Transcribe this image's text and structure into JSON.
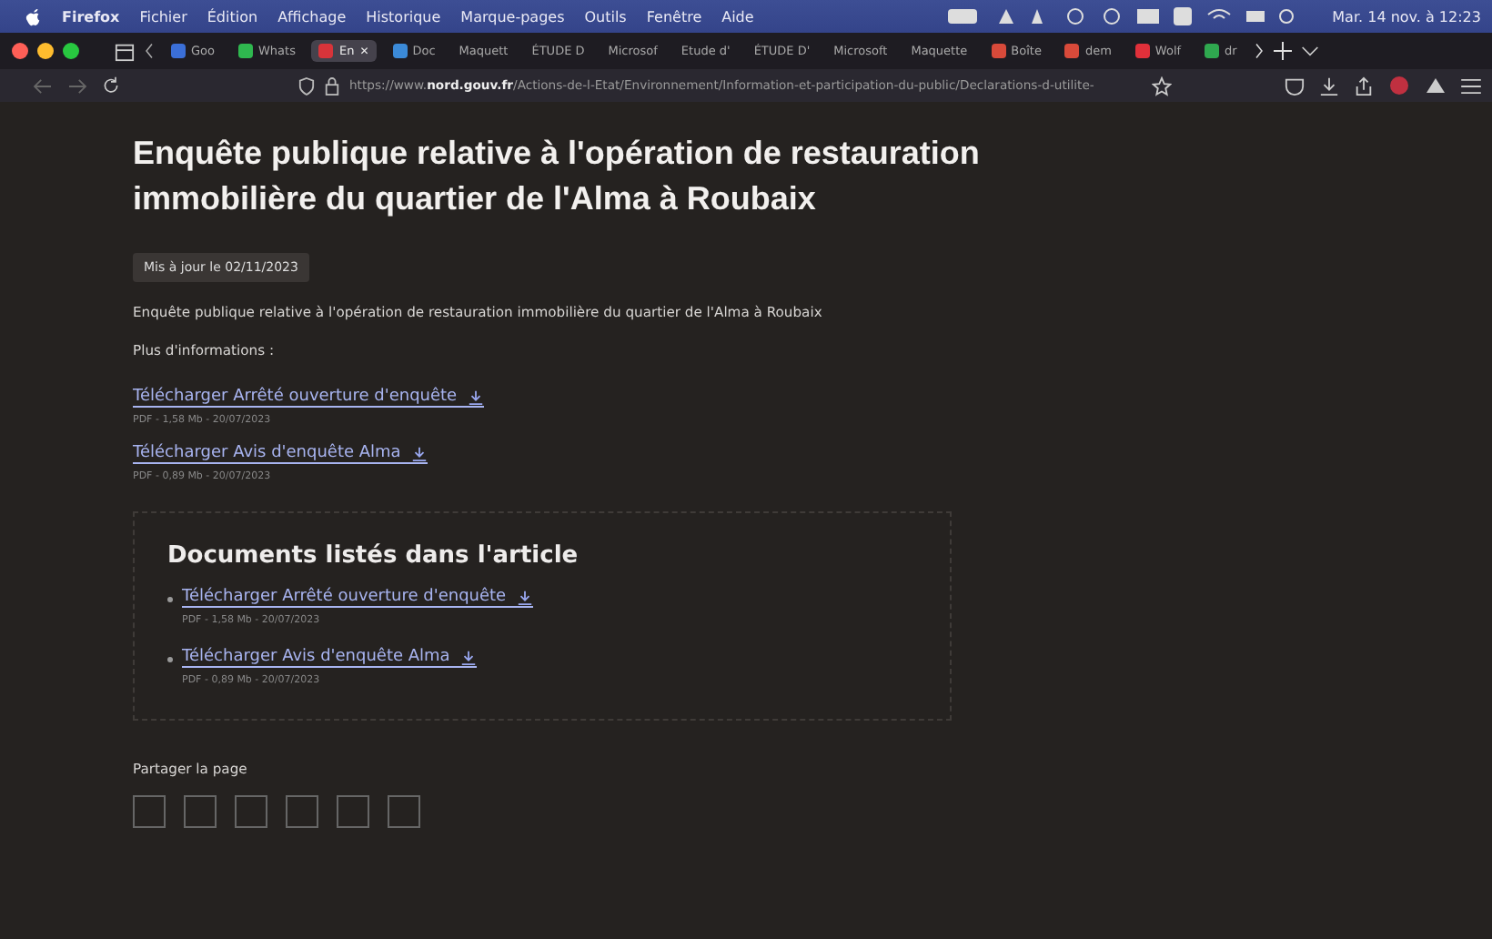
{
  "menu_bar": {
    "app": "Firefox",
    "items": [
      "Fichier",
      "Édition",
      "Affichage",
      "Historique",
      "Marque-pages",
      "Outils",
      "Fenêtre",
      "Aide"
    ],
    "clock": "Mar. 14 nov. à 12:23"
  },
  "tabs": [
    {
      "label": "Goo",
      "selected": false,
      "color": "#3b6fd8"
    },
    {
      "label": "Whats",
      "selected": false,
      "color": "#2fb84f"
    },
    {
      "label": "En",
      "selected": true,
      "color": "#d8343a",
      "close": "✕"
    },
    {
      "label": "Doc",
      "selected": false,
      "color": "#3b8ad8"
    },
    {
      "label": "Maquett",
      "selected": false
    },
    {
      "label": "ÉTUDE D",
      "selected": false
    },
    {
      "label": "Microsof",
      "selected": false
    },
    {
      "label": "Etude d'",
      "selected": false
    },
    {
      "label": "ÉTUDE D'",
      "selected": false
    },
    {
      "label": "Microsoft",
      "selected": false
    },
    {
      "label": "Maquette",
      "selected": false
    },
    {
      "label": "Boîte",
      "selected": false,
      "color": "#d84a3a"
    },
    {
      "label": "dem",
      "selected": false,
      "color": "#d84a3a"
    },
    {
      "label": "Wolf",
      "selected": false,
      "color": "#e0303a"
    },
    {
      "label": "dr",
      "selected": false,
      "color": "#2fa84f"
    }
  ],
  "address_bar": {
    "prefix": "https://www.",
    "domain": "nord.gouv.fr",
    "path": "/Actions-de-l-Etat/Environnement/Information-et-participation-du-public/Declarations-d-utilite-"
  },
  "article": {
    "title": "Enquête publique relative à l'opération de restauration immobilière du quartier de l'Alma à Roubaix",
    "updated": "Mis à jour le 02/11/2023",
    "intro": "Enquête publique relative à l'opération de restauration immobilière du quartier de l'Alma à Roubaix",
    "more_label": "Plus d'informations :",
    "downloads": [
      {
        "link": "Télécharger Arrêté ouverture d'enquête",
        "meta": "PDF - 1,58 Mb - 20/07/2023"
      },
      {
        "link": "Télécharger Avis d'enquête Alma",
        "meta": "PDF - 0,89 Mb - 20/07/2023"
      }
    ]
  },
  "documents": {
    "heading": "Documents listés dans l'article",
    "items": [
      {
        "link": "Télécharger Arrêté ouverture d'enquête",
        "meta": "PDF - 1,58 Mb - 20/07/2023"
      },
      {
        "link": "Télécharger Avis d'enquête Alma",
        "meta": "PDF - 0,89 Mb - 20/07/2023"
      }
    ]
  },
  "share": {
    "label": "Partager la page"
  }
}
